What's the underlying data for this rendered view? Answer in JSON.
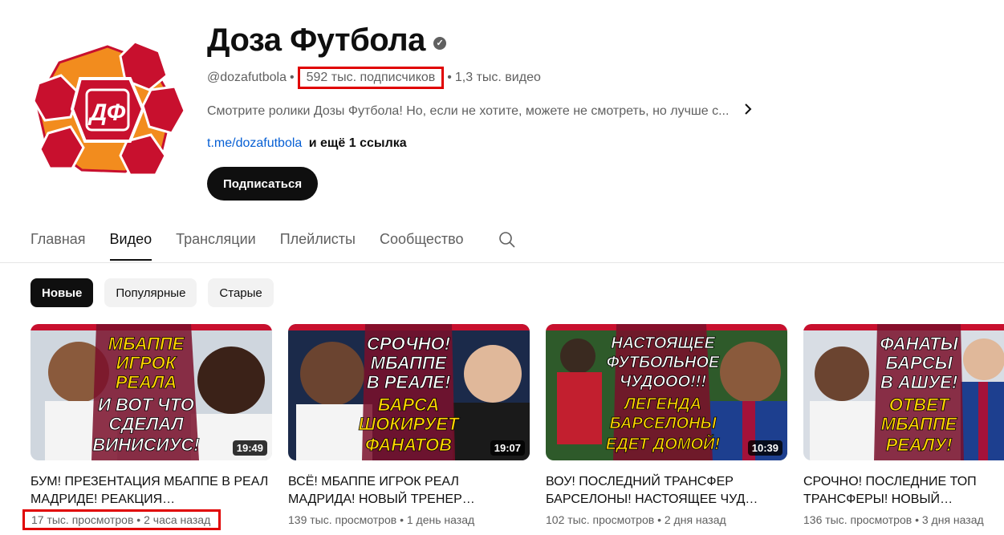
{
  "channel": {
    "name": "Доза Футбола",
    "handle": "@dozafutbola",
    "subscribers": "592 тыс. подписчиков",
    "videos_count": "1,3 тыс. видео",
    "description": "Смотрите ролики Дозы Футбола! Но, если не хотите, можете не смотреть, но лучше с...",
    "link": "t.me/dozafutbola",
    "more_links": "и ещё 1 ссылка",
    "subscribe_label": "Подписаться",
    "logo_text": "ДФ",
    "meta_separator": "•"
  },
  "tabs": [
    {
      "label": "Главная"
    },
    {
      "label": "Видео"
    },
    {
      "label": "Трансляции"
    },
    {
      "label": "Плейлисты"
    },
    {
      "label": "Сообщество"
    }
  ],
  "chips": [
    {
      "label": "Новые"
    },
    {
      "label": "Популярные"
    },
    {
      "label": "Старые"
    }
  ],
  "videos": [
    {
      "title": "БУМ! ПРЕЗЕНТАЦИЯ МБАППЕ В РЕАЛ МАДРИДЕ! РЕАКЦИЯ…",
      "duration": "19:49",
      "views": "17 тыс. просмотров",
      "age": "2 часа назад",
      "thumb_text": [
        "МБАППЕ",
        "ИГРОК",
        "РЕАЛА",
        "И ВОТ ЧТО",
        "СДЕЛАЛ",
        "ВИНИСИУС!"
      ]
    },
    {
      "title": "ВСЁ! МБАППЕ ИГРОК РЕАЛ МАДРИДА! НОВЫЙ ТРЕНЕР…",
      "duration": "19:07",
      "views": "139 тыс. просмотров",
      "age": "1 день назад",
      "thumb_text": [
        "СРОЧНО!",
        "МБАППЕ",
        "В РЕАЛЕ!",
        "БАРСА",
        "ШОКИРУЕТ",
        "ФАНАТОВ"
      ]
    },
    {
      "title": "ВОУ! ПОСЛЕДНИЙ ТРАНСФЕР БАРСЕЛОНЫ! НАСТОЯЩЕЕ ЧУД…",
      "duration": "10:39",
      "views": "102 тыс. просмотров",
      "age": "2 дня назад",
      "thumb_text": [
        "НАСТОЯЩЕЕ",
        "ФУТБОЛЬНОЕ",
        "ЧУДООО!!!",
        "ЛЕГЕНДА",
        "БАРСЕЛОНЫ",
        "ЕДЕТ ДОМОЙ!"
      ]
    },
    {
      "title": "СРОЧНО! ПОСЛЕДНИЕ ТОП ТРАНСФЕРЫ! НОВЫЙ ТРЕНЕР…",
      "duration": "",
      "views": "136 тыс. просмотров",
      "age": "3 дня назад",
      "thumb_text": [
        "ФАНАТЫ",
        "БАРСЫ",
        "В АШУЕ!",
        "ОТВЕТ",
        "МБАППЕ",
        "РЕАЛУ!"
      ]
    }
  ],
  "colors": {
    "highlight_box": "#e00000",
    "logo_orange": "#f28c1e",
    "logo_red": "#c8102e",
    "thumb_text_yellow": "#ffd400"
  }
}
